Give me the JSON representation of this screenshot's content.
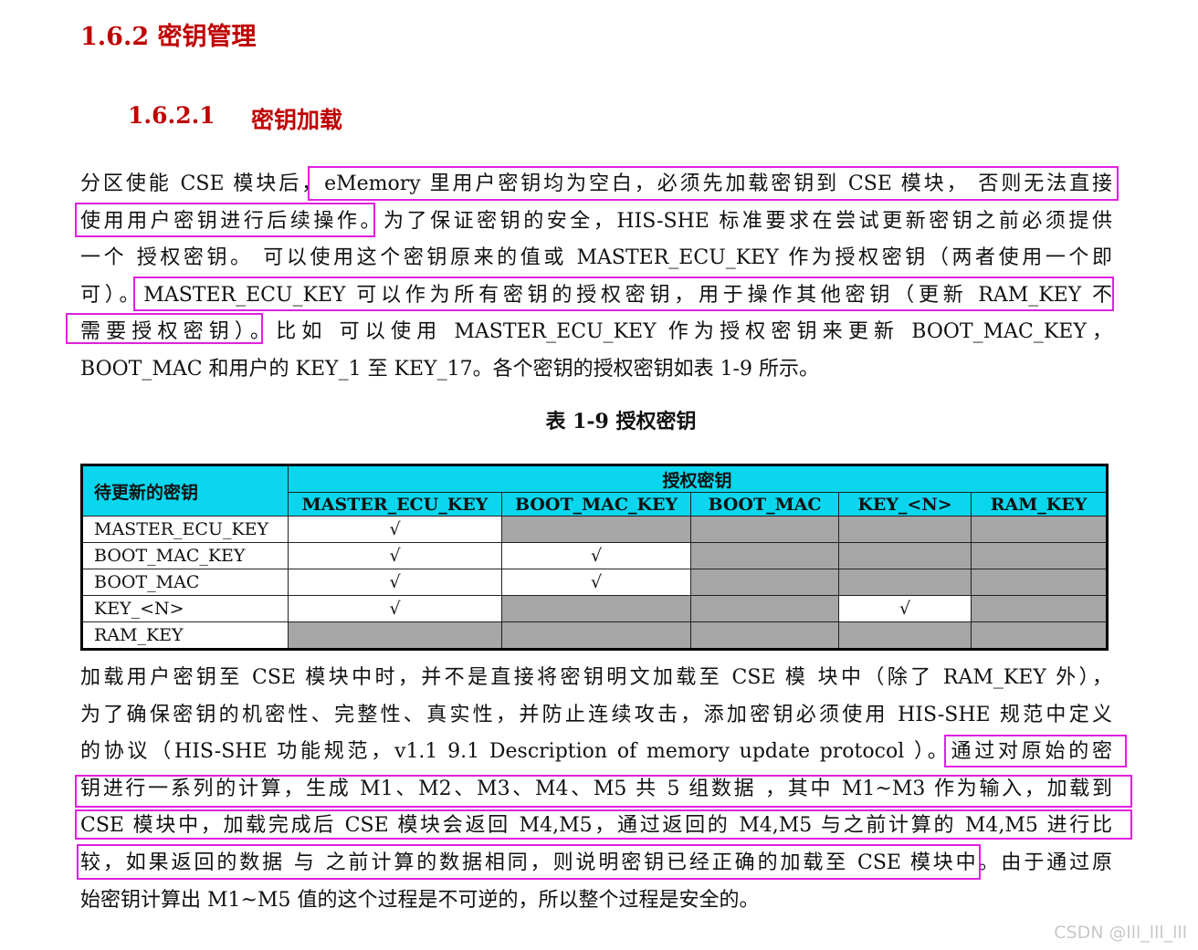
{
  "heading": {
    "h2": "1.6.2 密钥管理",
    "h3_num": "1.6.2.1",
    "h3_title": "密钥加载"
  },
  "para1": [
    "分区使能 CSE 模块后，eMemory 里用户密钥均为空白，必须先加载密钥到 CSE 模块， 否则无法直接",
    "使用用户密钥进行后续操作。为了保证密钥的安全，HIS-SHE 标准要求在尝试更新密钥之前必须提供",
    "一个 授权密钥。 可以使用这个密钥原来的值或 MASTER_ECU_KEY 作为授权密钥（两者使用一个即",
    "可）。MASTER_ECU_KEY 可以作为所有密钥的授权密钥，用于操作其他密钥（更新 RAM_KEY 不",
    "需要授权密钥）。比如 可以使用 MASTER_ECU_KEY 作为授权密钥来更新 BOOT_MAC_KEY，",
    "BOOT_MAC 和用户的 KEY_1 至 KEY_17。各个密钥的授权密钥如表 1-9 所示。"
  ],
  "table": {
    "caption": "表 1-9 授权密钥",
    "corner": "待更新的密钥",
    "group_header": "授权密钥",
    "columns": [
      "MASTER_ECU_KEY",
      "BOOT_MAC_KEY",
      "BOOT_MAC",
      "KEY_<N>",
      "RAM_KEY"
    ],
    "rows": [
      {
        "label": "MASTER_ECU_KEY",
        "cells": [
          "√",
          "",
          "",
          "",
          ""
        ]
      },
      {
        "label": "BOOT_MAC_KEY",
        "cells": [
          "√",
          "√",
          "",
          "",
          ""
        ]
      },
      {
        "label": "BOOT_MAC",
        "cells": [
          "√",
          "√",
          "",
          "",
          ""
        ]
      },
      {
        "label": "KEY_<N>",
        "cells": [
          "√",
          "",
          "",
          "√",
          ""
        ]
      },
      {
        "label": "RAM_KEY",
        "cells": [
          "",
          "",
          "",
          "",
          ""
        ]
      }
    ],
    "shading": [
      [
        false,
        true,
        true,
        true,
        true
      ],
      [
        false,
        false,
        true,
        true,
        true
      ],
      [
        false,
        false,
        true,
        true,
        true
      ],
      [
        false,
        true,
        true,
        false,
        true
      ],
      [
        true,
        true,
        true,
        true,
        true
      ]
    ],
    "colors": {
      "header": "#0ad6ee",
      "disabled": "#a6a6a6"
    }
  },
  "para2": [
    "加载用户密钥至 CSE 模块中时，并不是直接将密钥明文加载至 CSE 模 块中（除了 RAM_KEY 外），",
    "为了确保密钥的机密性、完整性、真实性，并防止连续攻击，添加密钥必须使用 HIS-SHE 规范中定义",
    "的协议（HIS-SHE 功能规范，v1.1 9.1 Description of memory update protocol ）。通过对原始的密",
    "钥进行一系列的计算，生成 M1、M2、M3、M4、M5 共 5 组数据 ，其中 M1~M3 作为输入，加载到",
    "CSE 模块中，加载完成后 CSE 模块会返回 M4,M5，通过返回的 M4,M5 与之前计算的 M4,M5 进行比",
    "较，如果返回的数据 与 之前计算的数据相同，则说明密钥已经正确的加载至 CSE 模块中。由于通过原",
    "始密钥计算出 M1~M5 值的这个过程是不可逆的，所以整个过程是安全的。"
  ],
  "watermark": "CSDN @lll_lll_lll",
  "highlight_color": "#e020e0"
}
